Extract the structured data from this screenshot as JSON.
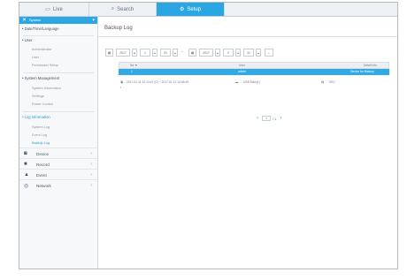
{
  "topnav": {
    "tabs": [
      {
        "icon": "monitor-icon",
        "glyph": "▭",
        "label": "Live"
      },
      {
        "icon": "search-icon",
        "glyph": "⌕",
        "label": "Search"
      },
      {
        "icon": "gear-icon",
        "glyph": "⚙",
        "label": "Setup"
      }
    ],
    "active_color": "#2aa7e2"
  },
  "sidebar": {
    "selected": {
      "icon": "close-icon",
      "glyph": "✕",
      "label": "System"
    },
    "groups": [
      {
        "label": "• Date/Time/Language"
      },
      {
        "label": "• User",
        "items": [
          "Administrator",
          "User",
          "Permission Setup"
        ]
      },
      {
        "label": "• System Management",
        "items": [
          "System Information",
          "Settings",
          "Power Control"
        ]
      },
      {
        "label": "• Log Information",
        "items": [
          "System Log",
          "Event Log",
          "Backup Log"
        ]
      }
    ],
    "main_items": [
      {
        "icon": "camera-icon",
        "glyph": "◙",
        "label": "Device"
      },
      {
        "icon": "record-icon",
        "glyph": "■",
        "label": "Record"
      },
      {
        "icon": "event-icon",
        "glyph": "▲",
        "label": "Event"
      },
      {
        "icon": "network-icon",
        "glyph": "◎",
        "label": "Network"
      }
    ]
  },
  "content": {
    "title": "Backup Log",
    "filters": {
      "start": {
        "year": "2017",
        "month": "1",
        "day": "31"
      },
      "end": {
        "year": "2017",
        "month": "2",
        "day": "31"
      },
      "separator": "~"
    },
    "table": {
      "headers": [
        "No.▼",
        "User",
        "Detail Info."
      ],
      "row": {
        "no": "1",
        "user": "admin",
        "detail": "Device for Backup"
      },
      "detail_info": {
        "range": "2017-01-11 10:13:47 (C) ~ 2017-01-11 10:48:45",
        "device": "USB Stick(1)",
        "format": "SEC"
      }
    },
    "pager": {
      "prev": "‹",
      "page": "1",
      "total": "/ 1",
      "next": "›"
    }
  }
}
